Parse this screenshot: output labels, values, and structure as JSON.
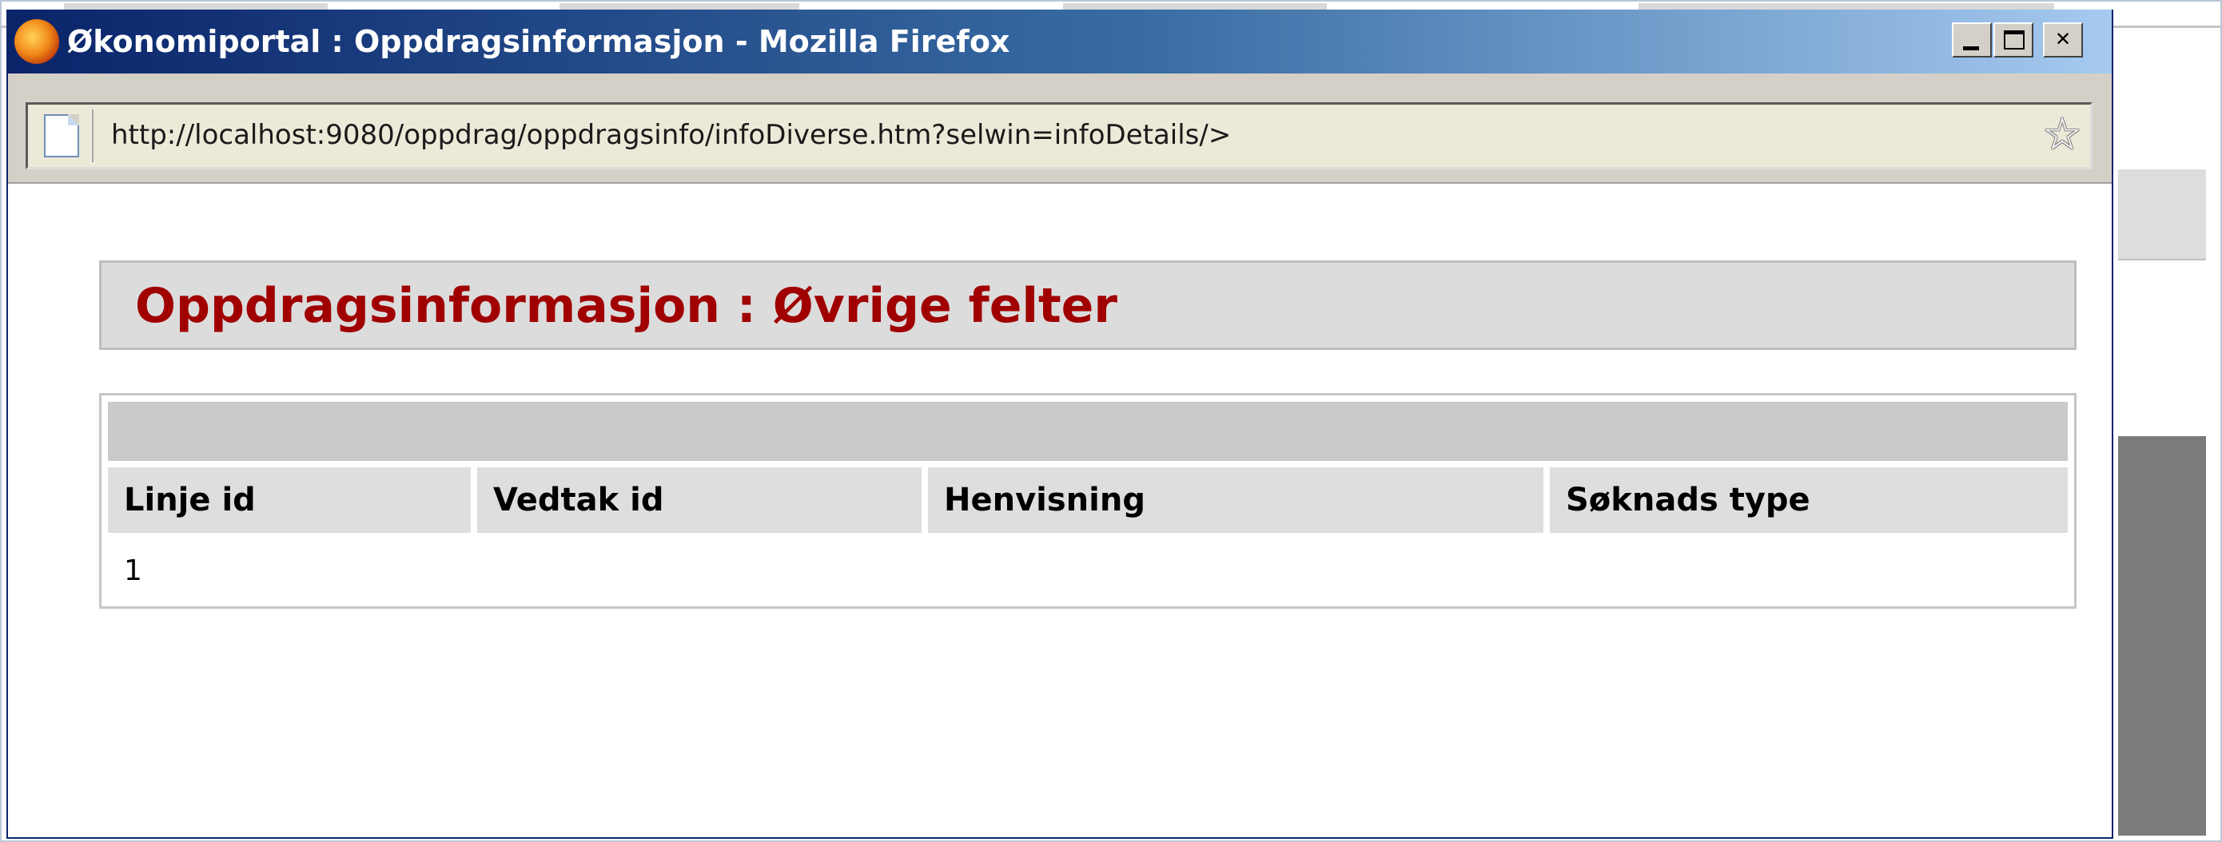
{
  "window": {
    "title": "Økonomiportal : Oppdragsinformasjon - Mozilla Firefox",
    "icon": "firefox-icon",
    "buttons": {
      "minimize": "_",
      "maximize": "□",
      "close": "✕"
    }
  },
  "addressbar": {
    "url": "http://localhost:9080/oppdrag/oppdragsinfo/infoDiverse.htm?selwin=infoDetails/>",
    "bookmark_icon": "star-icon"
  },
  "page": {
    "heading": "Oppdragsinformasjon : Øvrige felter",
    "table": {
      "caption": "",
      "columns": [
        "Linje id",
        "Vedtak id",
        "Henvisning",
        "Søknads type"
      ],
      "rows": [
        [
          "1",
          "",
          "",
          ""
        ]
      ]
    }
  },
  "colors": {
    "heading": "#a00000",
    "titlebar_start": "#0a246a",
    "titlebar_end": "#a6caf0"
  }
}
